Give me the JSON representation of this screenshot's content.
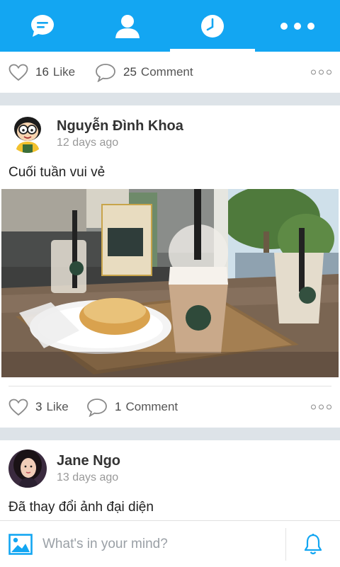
{
  "nav": {
    "tabs": [
      {
        "name": "messages",
        "icon": "chat-icon"
      },
      {
        "name": "profile",
        "icon": "user-icon"
      },
      {
        "name": "history",
        "icon": "clock-icon",
        "active": true
      },
      {
        "name": "more",
        "icon": "more-icon"
      }
    ],
    "accent": "#13a6f2"
  },
  "posts": [
    {
      "partial": true,
      "likes": "16",
      "like_label": "Like",
      "comments": "25",
      "comment_label": "Comment"
    },
    {
      "author": "Nguyễn Đình Khoa",
      "time": "12 days ago",
      "caption": "Cuối tuần vui vẻ",
      "likes": "3",
      "like_label": "Like",
      "comments": "1",
      "comment_label": "Comment"
    },
    {
      "author": "Jane Ngo",
      "time": "13 days ago",
      "caption": "Đã thay đổi ảnh đại diện"
    }
  ],
  "composer": {
    "placeholder": "What's in your mind?"
  }
}
